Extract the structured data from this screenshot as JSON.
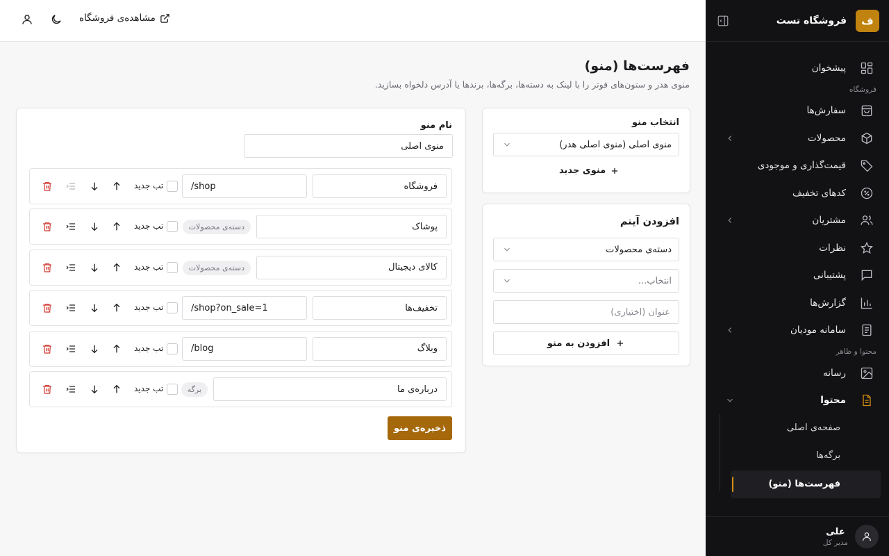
{
  "brand": {
    "logo_letter": "ف",
    "name": "فروشگاه تست",
    "accent": "#d48d12",
    "button_color": "#a5680b"
  },
  "sidebar": {
    "dashboard": "پیشخوان",
    "section_store": "فروشگاه",
    "orders": "سفارش‌ها",
    "products": "محصولات",
    "pricing": "قیمت‌گذاری و موجودی",
    "discounts": "کدهای تخفیف",
    "customers": "مشتریان",
    "reviews": "نظرات",
    "support": "پشتیبانی",
    "reports": "گزارش‌ها",
    "tax": "سامانه مودیان",
    "section_content": "محتوا و ظاهر",
    "media": "رسانه",
    "content": "محتوا",
    "sub_home": "صفحه‌ی اصلی",
    "sub_pages": "برگه‌ها",
    "sub_menus": "فهرست‌ها (منو)"
  },
  "user": {
    "name": "علی",
    "role": "مدیر کل"
  },
  "topbar": {
    "view_store": "مشاهده‌ی فروشگاه"
  },
  "page": {
    "title": "فهرست‌ها (منو)",
    "subtitle": "منوی هدر و ستون‌های فوتر را با لینک به دسته‌ها، برگه‌ها، برندها یا آدرس دلخواه بسازید."
  },
  "select_menu": {
    "label": "انتخاب منو",
    "value": "منوی اصلی (منوی اصلی هدر)",
    "new_menu": "منوی جدید"
  },
  "add_item": {
    "title": "افزودن آیتم",
    "type_value": "دسته‌ی محصولات",
    "choose_placeholder": "انتخاب...",
    "title_placeholder": "عنوان (اختیاری)",
    "add_button": "افزودن به منو"
  },
  "editor": {
    "name_label": "نام منو",
    "name_value": "منوی اصلی",
    "new_tab_label": "تب جدید",
    "save_button": "ذخیره‌ی منو",
    "items": [
      {
        "title": "فروشگاه",
        "url": "/shop"
      },
      {
        "title": "پوشاک",
        "chip": "دسته‌ی محصولات"
      },
      {
        "title": "کالای دیجیتال",
        "chip": "دسته‌ی محصولات"
      },
      {
        "title": "تخفیف‌ها",
        "url": "/shop?on_sale=1"
      },
      {
        "title": "وبلاگ",
        "url": "/blog"
      },
      {
        "title": "درباره‌ی ما",
        "chip": "برگه"
      }
    ]
  }
}
